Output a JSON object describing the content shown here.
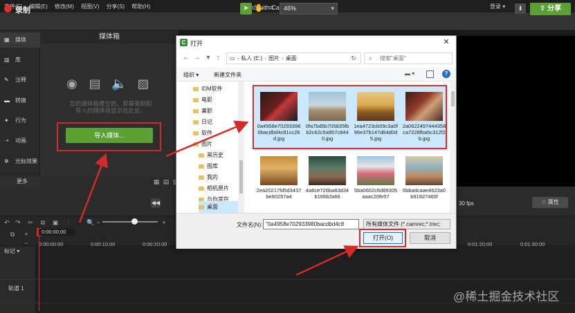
{
  "window": {
    "title": "TechSmith Camtasia - 无标题项目",
    "menu": [
      "文件(F)",
      "编辑(E)",
      "修改(M)",
      "视图(V)",
      "分享(S)",
      "帮助(H)"
    ],
    "login": "登录 ▾",
    "controls": [
      "—",
      "❐",
      "✕"
    ]
  },
  "toolbar": {
    "record_label": "录制",
    "zoom": "46%",
    "share_label": "分享",
    "accent": "#5aa033"
  },
  "rail": {
    "items": [
      {
        "icon": "media-icon",
        "glyph": "▦",
        "label": "媒体"
      },
      {
        "icon": "library-icon",
        "glyph": "▥",
        "label": "库"
      },
      {
        "icon": "annotation-icon",
        "glyph": "✎",
        "label": "注释"
      },
      {
        "icon": "transition-icon",
        "glyph": "▬",
        "label": "转换"
      },
      {
        "icon": "behavior-icon",
        "glyph": "✦",
        "label": "行为"
      },
      {
        "icon": "animation-icon",
        "glyph": "➝",
        "label": "动画"
      },
      {
        "icon": "cursor-effect-icon",
        "glyph": "✲",
        "label": "光标效果"
      }
    ],
    "more": "更多"
  },
  "bin": {
    "title": "媒体箱",
    "message": "您的媒体箱是空的。屏幕录制和导入的媒体将显示在此处。",
    "import_label": "导入媒体..."
  },
  "playback": {
    "fps": "30 fps",
    "properties": "属性"
  },
  "timeline": {
    "time": "0:00:00;00",
    "ticks": [
      "0:00:00;00",
      "0:00:10;00",
      "0:00:20;00",
      "0:01:20;00",
      "0:01:30;00"
    ],
    "mark_label": "标记",
    "track1": "轨道 1",
    "watermark": "@稀土掘金技术社区"
  },
  "dialog": {
    "title": "打开",
    "path": [
      "私人 (E:)",
      "图片",
      "桌面"
    ],
    "search_placeholder": "搜索\"桌面\"",
    "organize": "组织 ▾",
    "new_folder": "新建文件夹",
    "tree": [
      "IDM软件",
      "电影",
      "兼职",
      "日记",
      "软件",
      "图片",
      "黑历史",
      "图库",
      "我的",
      "相机原片",
      "与你常在",
      "桌面"
    ],
    "files": [
      {
        "name": "0a4958e702933980bacdbd4c81cc26d.jpg",
        "selected": true
      },
      {
        "name": "0fa7bd5b705835fbb2c62c5a957c8440.jpg",
        "selected": true
      },
      {
        "name": "1ea4723cb09c3a0f96e37b147d64d0d5.jpg",
        "selected": true
      },
      {
        "name": "2a0622497444358ca7228fba5c312f2b.jpg",
        "selected": true
      },
      {
        "name": "2ea20217fd5d3437be90257a4",
        "selected": false
      },
      {
        "name": "4a6ce726ba83d34b16fdcfa66",
        "selected": false
      },
      {
        "name": "5ba0602c6d89305aaac20fe57",
        "selected": false
      },
      {
        "name": "6bbadcaae4623a0b91827460f",
        "selected": false
      }
    ],
    "filename_label": "文件名(N):",
    "filename_value": "\"0a4958e702933980bacdbd4c8",
    "filter": "所有媒体文件 (*.camrec;*.trec;",
    "open_label": "打开(O)",
    "cancel_label": "取消"
  }
}
